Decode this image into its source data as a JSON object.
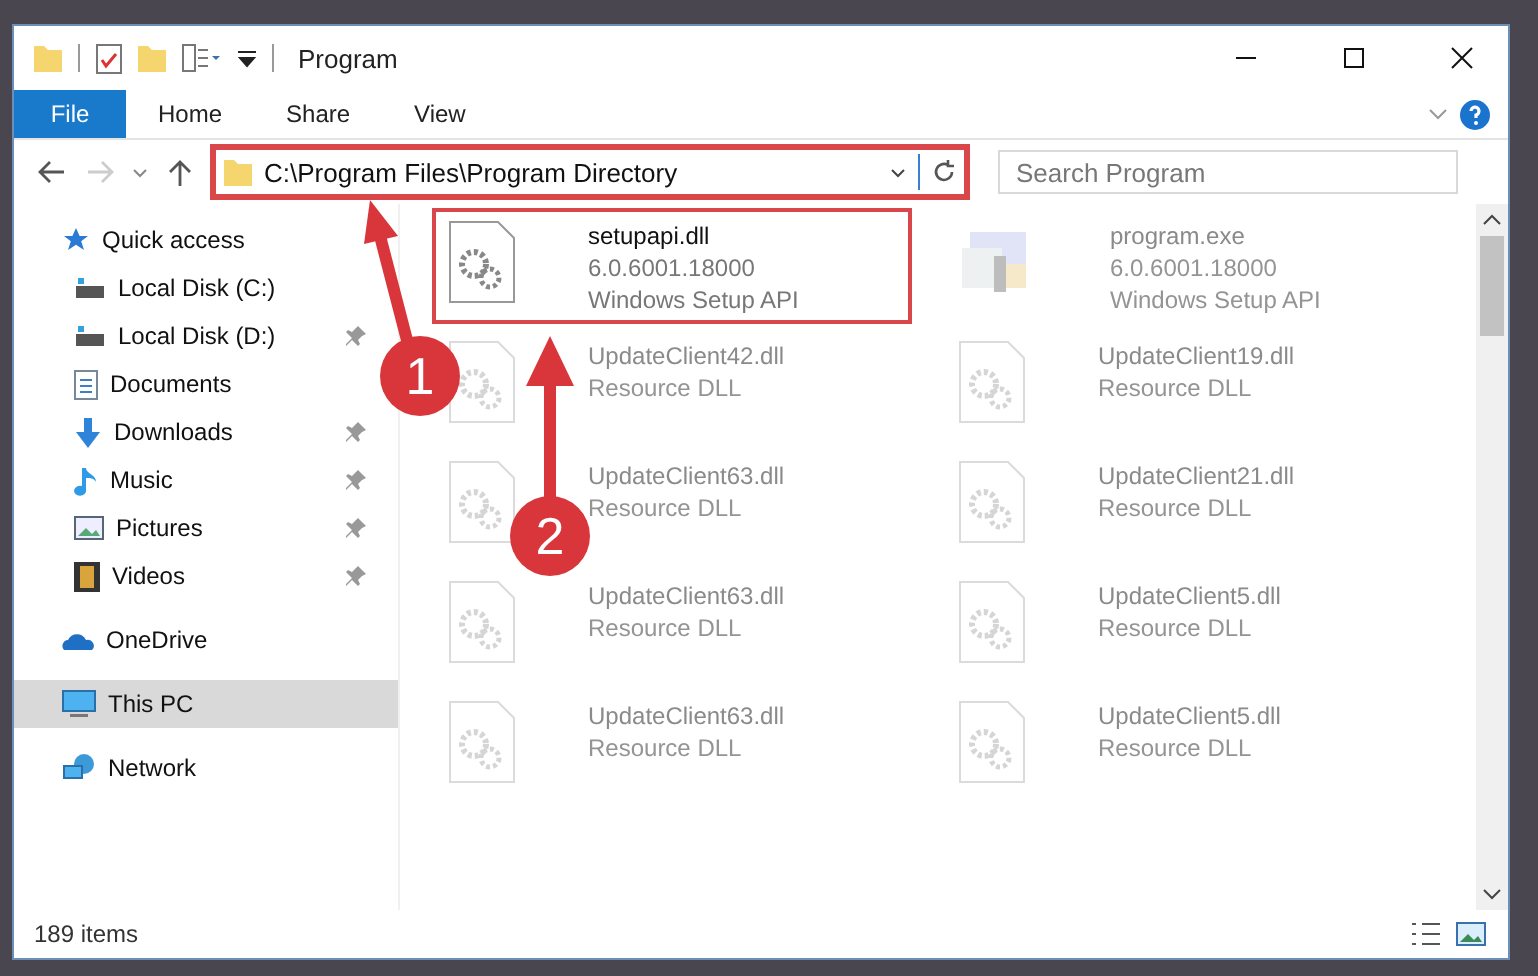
{
  "window": {
    "title": "Program"
  },
  "ribbon_tabs": [
    {
      "label": "File",
      "selected": true
    },
    {
      "label": "Home",
      "selected": false
    },
    {
      "label": "Share",
      "selected": false
    },
    {
      "label": "View",
      "selected": false
    }
  ],
  "address": {
    "value": "C:\\Program Files\\Program Directory",
    "highlighted": true
  },
  "search": {
    "placeholder": "Search Program"
  },
  "sidebar": {
    "items": [
      {
        "label": "Quick access",
        "kind": "star",
        "selected": false,
        "children": [
          {
            "label": "Local Disk (C:)",
            "kind": "disk",
            "pinned": false
          },
          {
            "label": "Local Disk (D:)",
            "kind": "disk",
            "pinned": true
          },
          {
            "label": "Documents",
            "kind": "document",
            "pinned": false
          },
          {
            "label": "Downloads",
            "kind": "download",
            "pinned": true
          },
          {
            "label": "Music",
            "kind": "music",
            "pinned": true
          },
          {
            "label": "Pictures",
            "kind": "picture",
            "pinned": true
          },
          {
            "label": "Videos",
            "kind": "video",
            "pinned": true
          }
        ]
      },
      {
        "label": "OneDrive",
        "kind": "cloud",
        "selected": false
      },
      {
        "label": "This PC",
        "kind": "pc",
        "selected": true
      },
      {
        "label": "Network",
        "kind": "network",
        "selected": false
      }
    ]
  },
  "files": [
    {
      "name": "setupapi.dll",
      "lines": [
        "6.0.6001.18000",
        "Windows Setup API"
      ],
      "kind": "dll",
      "focused": true
    },
    {
      "name": "program.exe",
      "lines": [
        "6.0.6001.18000",
        "Windows Setup API"
      ],
      "kind": "exe",
      "focused": false
    },
    {
      "name": "UpdateClient42.dll",
      "lines": [
        "Resource DLL"
      ],
      "kind": "dll",
      "focused": false
    },
    {
      "name": "UpdateClient19.dll",
      "lines": [
        "Resource DLL"
      ],
      "kind": "dll",
      "focused": false
    },
    {
      "name": "UpdateClient63.dll",
      "lines": [
        "Resource DLL"
      ],
      "kind": "dll",
      "focused": false
    },
    {
      "name": "UpdateClient21.dll",
      "lines": [
        "Resource DLL"
      ],
      "kind": "dll",
      "focused": false
    },
    {
      "name": "UpdateClient63.dll",
      "lines": [
        "Resource DLL"
      ],
      "kind": "dll",
      "focused": false
    },
    {
      "name": "UpdateClient5.dll",
      "lines": [
        "Resource DLL"
      ],
      "kind": "dll",
      "focused": false
    },
    {
      "name": "UpdateClient63.dll",
      "lines": [
        "Resource DLL"
      ],
      "kind": "dll",
      "focused": false
    },
    {
      "name": "UpdateClient5.dll",
      "lines": [
        "Resource DLL"
      ],
      "kind": "dll",
      "focused": false
    }
  ],
  "status_bar": {
    "count": "189 items"
  },
  "callouts": [
    {
      "number": "1"
    },
    {
      "number": "2"
    }
  ]
}
